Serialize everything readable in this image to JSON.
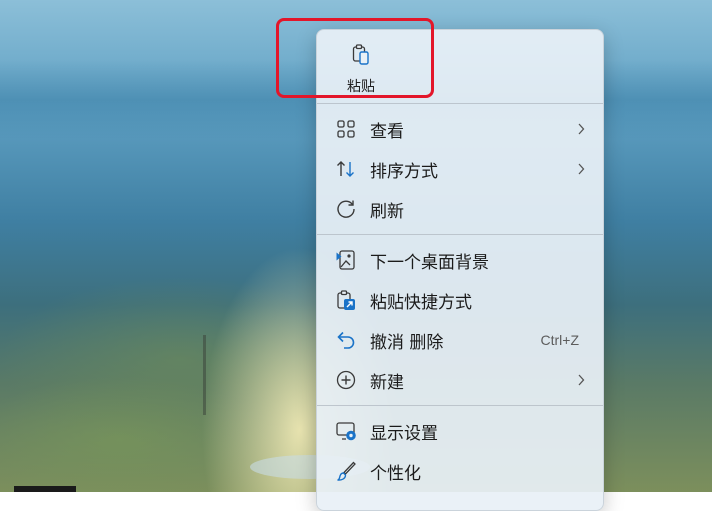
{
  "menu": {
    "paste": {
      "label": "粘贴",
      "icon": "paste-icon"
    },
    "items": [
      {
        "label": "查看",
        "icon": "grid-view-icon",
        "has_submenu": true
      },
      {
        "label": "排序方式",
        "icon": "sort-icon",
        "has_submenu": true
      },
      {
        "label": "刷新",
        "icon": "refresh-icon",
        "has_submenu": false
      },
      {
        "label": "下一个桌面背景",
        "icon": "next-background-icon",
        "has_submenu": false
      },
      {
        "label": "粘贴快捷方式",
        "icon": "paste-shortcut-icon",
        "has_submenu": false
      },
      {
        "label": "撤消 删除",
        "icon": "undo-icon",
        "shortcut": "Ctrl+Z"
      },
      {
        "label": "新建",
        "icon": "new-icon",
        "has_submenu": true
      },
      {
        "label": "显示设置",
        "icon": "display-settings-icon",
        "has_submenu": false
      },
      {
        "label": "个性化",
        "icon": "personalize-brush-icon",
        "has_submenu": false
      }
    ]
  },
  "colors": {
    "accent_blue": "#1a73c8",
    "highlight_red": "#e3162a",
    "menu_bg": "#e8f0f6"
  }
}
